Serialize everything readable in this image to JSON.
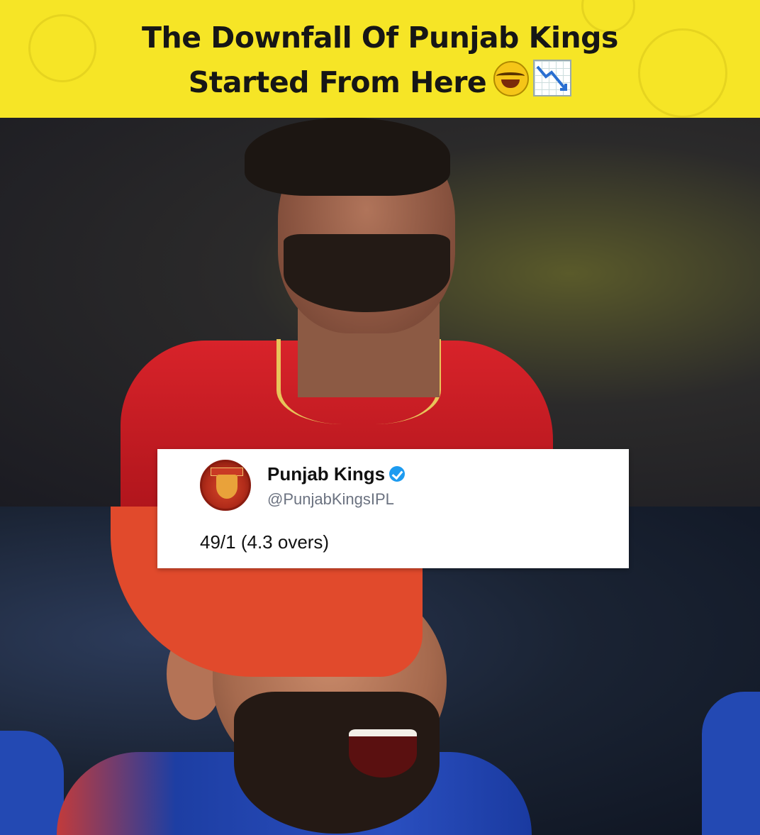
{
  "banner": {
    "headline_line1": "The Downfall Of Punjab Kings",
    "headline_line2": "Started From Here",
    "emoji_1": "face-with-tears-of-joy",
    "emoji_2": "chart-decreasing",
    "background": "#f6e526"
  },
  "tweet": {
    "display_name": "Punjab Kings",
    "handle": "@PunjabKingsIPL",
    "verified": true,
    "text": "49/1 (4.3 overs)",
    "avatar_icon": "punjab-kings-logo"
  },
  "photos": {
    "top": "player-in-red-jersey",
    "bottom": "player-in-red-cap-laughing"
  }
}
